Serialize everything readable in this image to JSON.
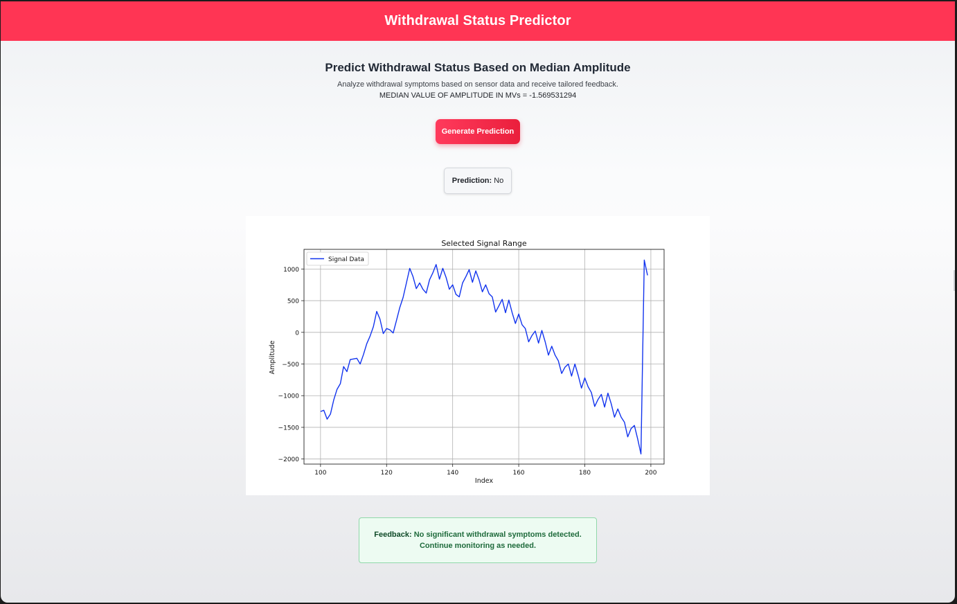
{
  "header": {
    "title": "Withdrawal Status Predictor"
  },
  "main": {
    "title": "Predict Withdrawal Status Based on Median Amplitude",
    "subtitle": "Analyze withdrawal symptoms based on sensor data and receive tailored feedback.",
    "median_text": "MEDIAN VALUE OF AMPLITUDE IN MVs = -1.569531294",
    "generate_button_label": "Generate Prediction",
    "prediction": {
      "label": "Prediction:",
      "value": "No"
    }
  },
  "feedback": {
    "label": "Feedback:",
    "line1": "No significant withdrawal symptoms detected.",
    "line2": "Continue monitoring as needed."
  },
  "colors": {
    "accent": "#ff3554",
    "line": "#1133ee",
    "feedback_border": "#8fd8a9",
    "feedback_bg": "#edfbf2"
  },
  "chart_data": {
    "type": "line",
    "title": "Selected Signal Range",
    "xlabel": "Index",
    "ylabel": "Amplitude",
    "xlim": [
      95,
      204
    ],
    "ylim": [
      -2080,
      1310
    ],
    "xticks": [
      100,
      120,
      140,
      160,
      180,
      200
    ],
    "yticks": [
      1000,
      500,
      0,
      -500,
      -1000,
      -1500,
      -2000
    ],
    "grid": true,
    "legend_position": "top-left",
    "series": [
      {
        "name": "Signal Data",
        "color": "#1133ee",
        "x": [
          100,
          101,
          102,
          103,
          104,
          105,
          106,
          107,
          108,
          109,
          110,
          111,
          112,
          113,
          114,
          115,
          116,
          117,
          118,
          119,
          120,
          121,
          122,
          123,
          124,
          125,
          126,
          127,
          128,
          129,
          130,
          131,
          132,
          133,
          134,
          135,
          136,
          137,
          138,
          139,
          140,
          141,
          142,
          143,
          144,
          145,
          146,
          147,
          148,
          149,
          150,
          151,
          152,
          153,
          154,
          155,
          156,
          157,
          158,
          159,
          160,
          161,
          162,
          163,
          164,
          165,
          166,
          167,
          168,
          169,
          170,
          171,
          172,
          173,
          174,
          175,
          176,
          177,
          178,
          179,
          180,
          181,
          182,
          183,
          184,
          185,
          186,
          187,
          188,
          189,
          190,
          191,
          192,
          193,
          194,
          195,
          196,
          197,
          198,
          199
        ],
        "y": [
          -1250,
          -1230,
          -1370,
          -1290,
          -1070,
          -900,
          -810,
          -540,
          -620,
          -430,
          -420,
          -410,
          -500,
          -350,
          -180,
          -60,
          90,
          330,
          210,
          -20,
          60,
          40,
          -10,
          190,
          390,
          550,
          780,
          1010,
          880,
          690,
          780,
          680,
          620,
          830,
          940,
          1070,
          840,
          1010,
          870,
          680,
          750,
          600,
          560,
          780,
          880,
          990,
          790,
          970,
          830,
          640,
          750,
          610,
          560,
          320,
          420,
          520,
          310,
          510,
          310,
          140,
          290,
          120,
          60,
          -150,
          -50,
          20,
          -170,
          30,
          -150,
          -360,
          -220,
          -360,
          -450,
          -650,
          -550,
          -500,
          -690,
          -500,
          -680,
          -880,
          -720,
          -860,
          -950,
          -1170,
          -1060,
          -980,
          -1180,
          -960,
          -1130,
          -1340,
          -1210,
          -1340,
          -1420,
          -1650,
          -1520,
          -1470,
          -1680,
          -1920,
          1140,
          900
        ]
      }
    ]
  }
}
